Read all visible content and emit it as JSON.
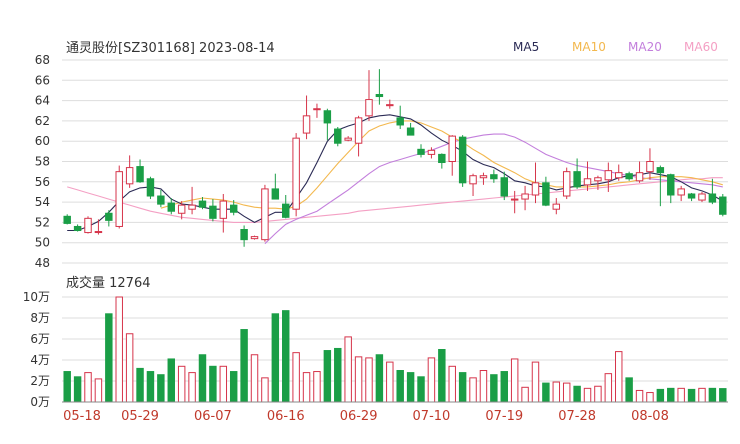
{
  "header": {
    "title": "通灵股份[SZ301168] 2023-08-14",
    "legend": [
      {
        "label": "MA5",
        "color": "#2b2b55"
      },
      {
        "label": "MA10",
        "color": "#f3b84e"
      },
      {
        "label": "MA20",
        "color": "#c37fdc"
      },
      {
        "label": "MA60",
        "color": "#f4a0c4"
      }
    ]
  },
  "colors": {
    "up": "#d6344a",
    "down": "#1a9e46",
    "grid": "#dddddd",
    "axis_text": "#333333",
    "date_text": "#c0392b"
  },
  "chart_data": [
    {
      "type": "candlestick",
      "ylim": [
        48,
        68
      ],
      "yticks": [
        48,
        50,
        52,
        54,
        56,
        58,
        60,
        62,
        64,
        66,
        68
      ],
      "x_labels": [
        {
          "index": 0,
          "label": "05-18"
        },
        {
          "index": 7,
          "label": "05-29"
        },
        {
          "index": 14,
          "label": "06-07"
        },
        {
          "index": 21,
          "label": "06-16"
        },
        {
          "index": 28,
          "label": "06-29"
        },
        {
          "index": 35,
          "label": "07-10"
        },
        {
          "index": 42,
          "label": "07-19"
        },
        {
          "index": 49,
          "label": "07-28"
        },
        {
          "index": 56,
          "label": "08-08"
        }
      ],
      "ohlc": [
        [
          52.6,
          52.8,
          51.8,
          51.9
        ],
        [
          51.6,
          51.8,
          51.1,
          51.2
        ],
        [
          51.0,
          52.6,
          50.9,
          52.4
        ],
        [
          51.1,
          52.3,
          50.8,
          51.1
        ],
        [
          52.9,
          53.2,
          51.6,
          52.2
        ],
        [
          51.6,
          57.6,
          51.4,
          57.0
        ],
        [
          55.8,
          58.6,
          55.4,
          57.4
        ],
        [
          57.5,
          58.2,
          55.9,
          56.0
        ],
        [
          56.3,
          56.5,
          54.3,
          54.6
        ],
        [
          54.6,
          55.2,
          53.5,
          53.8
        ],
        [
          53.9,
          54.4,
          52.8,
          53.1
        ],
        [
          52.9,
          54.1,
          52.3,
          53.7
        ],
        [
          53.3,
          55.5,
          52.8,
          53.7
        ],
        [
          54.1,
          54.5,
          53.3,
          53.5
        ],
        [
          53.6,
          54.3,
          52.1,
          52.4
        ],
        [
          52.4,
          54.8,
          51.0,
          54.1
        ],
        [
          53.7,
          54.2,
          52.7,
          53.0
        ],
        [
          51.3,
          51.7,
          49.6,
          50.3
        ],
        [
          50.4,
          50.7,
          50.3,
          50.6
        ],
        [
          50.3,
          55.7,
          50.1,
          55.3
        ],
        [
          55.3,
          56.8,
          54.3,
          54.3
        ],
        [
          53.8,
          54.7,
          52.4,
          52.5
        ],
        [
          53.3,
          60.8,
          52.6,
          60.3
        ],
        [
          60.8,
          64.5,
          60.2,
          62.5
        ],
        [
          63.2,
          63.7,
          62.3,
          63.2
        ],
        [
          63.0,
          63.2,
          60.1,
          61.8
        ],
        [
          61.2,
          61.4,
          59.5,
          59.8
        ],
        [
          60.1,
          60.5,
          60.0,
          60.3
        ],
        [
          59.8,
          62.5,
          58.5,
          62.3
        ],
        [
          62.5,
          67.0,
          62.0,
          64.1
        ],
        [
          64.6,
          67.1,
          63.6,
          64.4
        ],
        [
          63.5,
          64.1,
          63.2,
          63.6
        ],
        [
          62.3,
          63.5,
          61.2,
          61.6
        ],
        [
          61.3,
          61.8,
          60.6,
          60.6
        ],
        [
          59.2,
          59.7,
          58.4,
          58.7
        ],
        [
          58.7,
          59.4,
          58.3,
          59.1
        ],
        [
          58.7,
          58.8,
          57.3,
          57.9
        ],
        [
          58.0,
          60.6,
          56.6,
          60.5
        ],
        [
          60.4,
          60.6,
          55.5,
          55.9
        ],
        [
          55.8,
          56.8,
          54.6,
          56.6
        ],
        [
          56.4,
          56.9,
          55.7,
          56.6
        ],
        [
          56.7,
          57.2,
          55.9,
          56.3
        ],
        [
          56.4,
          57.0,
          54.2,
          54.6
        ],
        [
          54.2,
          55.1,
          52.9,
          54.3
        ],
        [
          54.3,
          55.6,
          53.2,
          54.8
        ],
        [
          54.7,
          57.9,
          53.9,
          55.9
        ],
        [
          55.9,
          56.5,
          53.6,
          53.7
        ],
        [
          53.3,
          54.4,
          52.8,
          53.8
        ],
        [
          54.6,
          57.4,
          54.3,
          57.0
        ],
        [
          57.0,
          58.3,
          55.3,
          55.5
        ],
        [
          55.7,
          58.0,
          55.1,
          56.3
        ],
        [
          56.1,
          56.6,
          55.2,
          56.4
        ],
        [
          56.2,
          57.9,
          55.0,
          57.1
        ],
        [
          56.4,
          57.7,
          56.1,
          56.9
        ],
        [
          56.8,
          57.0,
          56.1,
          56.3
        ],
        [
          56.1,
          58.0,
          55.9,
          56.9
        ],
        [
          57.0,
          59.3,
          56.2,
          58.0
        ],
        [
          57.4,
          57.6,
          53.6,
          56.9
        ],
        [
          56.7,
          56.8,
          53.9,
          54.7
        ],
        [
          54.7,
          55.6,
          54.1,
          55.3
        ],
        [
          54.8,
          54.9,
          54.1,
          54.4
        ],
        [
          54.2,
          55.0,
          54.0,
          54.8
        ],
        [
          54.8,
          56.3,
          53.8,
          54.0
        ],
        [
          54.5,
          54.8,
          52.6,
          52.8
        ]
      ],
      "ma5": [
        51.2,
        51.2,
        51.6,
        52.1,
        53.0,
        54.1,
        55.0,
        55.4,
        55.5,
        55.3,
        54.3,
        53.8,
        53.7,
        53.5,
        53.3,
        53.3,
        53.3,
        52.6,
        52.0,
        52.5,
        53.0,
        53.0,
        54.4,
        55.9,
        57.9,
        60.0,
        61.1,
        61.5,
        61.8,
        62.3,
        62.5,
        62.6,
        62.4,
        62.2,
        61.6,
        60.8,
        60.1,
        59.6,
        59.0,
        58.2,
        57.7,
        57.4,
        56.8,
        56.1,
        55.9,
        55.6,
        55.5,
        55.2,
        55.4,
        55.6,
        55.7,
        55.8,
        56.0,
        56.4,
        56.6,
        56.7,
        56.9,
        56.7,
        56.5,
        56.0,
        55.4,
        55.1,
        54.7,
        54.1
      ],
      "ma10": [
        null,
        null,
        null,
        null,
        null,
        null,
        null,
        null,
        null,
        53.4,
        53.7,
        54.0,
        54.2,
        54.4,
        54.3,
        54.2,
        54.0,
        53.7,
        53.5,
        53.4,
        53.4,
        53.3,
        53.6,
        54.3,
        55.4,
        56.6,
        57.8,
        58.9,
        60.0,
        61.0,
        61.5,
        61.8,
        62.0,
        62.0,
        61.8,
        61.4,
        61.0,
        60.4,
        59.9,
        59.2,
        58.6,
        57.9,
        57.4,
        56.9,
        56.3,
        55.9,
        55.7,
        55.5,
        55.5,
        55.5,
        55.5,
        55.6,
        55.7,
        55.9,
        56.0,
        56.2,
        56.4,
        56.5,
        56.5,
        56.5,
        56.4,
        56.2,
        56.0,
        55.7
      ],
      "ma20": [
        null,
        null,
        null,
        null,
        null,
        null,
        null,
        null,
        null,
        null,
        null,
        null,
        null,
        null,
        null,
        null,
        null,
        null,
        null,
        49.9,
        50.9,
        51.8,
        52.3,
        52.7,
        53.1,
        53.8,
        54.5,
        55.2,
        56.0,
        56.8,
        57.5,
        57.9,
        58.2,
        58.5,
        58.8,
        59.1,
        59.5,
        59.9,
        60.2,
        60.4,
        60.6,
        60.7,
        60.7,
        60.4,
        59.9,
        59.3,
        58.7,
        58.3,
        57.9,
        57.6,
        57.4,
        57.2,
        57.0,
        56.8,
        56.6,
        56.4,
        56.3,
        56.2,
        56.1,
        56.0,
        55.9,
        55.8,
        55.7,
        55.5
      ],
      "ma60": [
        55.5,
        55.2,
        54.9,
        54.6,
        54.3,
        54.0,
        53.7,
        53.4,
        53.1,
        52.9,
        52.7,
        52.5,
        52.4,
        52.3,
        52.2,
        52.1,
        52.0,
        52.0,
        52.0,
        52.1,
        52.2,
        52.3,
        52.4,
        52.5,
        52.6,
        52.7,
        52.8,
        52.9,
        53.1,
        53.2,
        53.3,
        53.4,
        53.5,
        53.6,
        53.7,
        53.8,
        53.9,
        54.0,
        54.1,
        54.2,
        54.3,
        54.4,
        54.5,
        54.6,
        54.7,
        54.8,
        54.9,
        55.0,
        55.1,
        55.2,
        55.3,
        55.4,
        55.5,
        55.6,
        55.7,
        55.8,
        55.9,
        56.0,
        56.1,
        56.2,
        56.3,
        56.3,
        56.4,
        56.4
      ]
    },
    {
      "type": "bar",
      "title": "成交量 12764",
      "yticks": [
        {
          "value": 0,
          "label": "0万"
        },
        {
          "value": 20000,
          "label": "2万"
        },
        {
          "value": 40000,
          "label": "4万"
        },
        {
          "value": 60000,
          "label": "6万"
        },
        {
          "value": 80000,
          "label": "8万"
        },
        {
          "value": 100000,
          "label": "10万"
        }
      ],
      "ylim": [
        0,
        100000
      ],
      "values": [
        29000,
        24000,
        28000,
        22000,
        84000,
        100000,
        65000,
        32000,
        29000,
        26000,
        41000,
        34000,
        28000,
        45000,
        34000,
        34000,
        29000,
        69000,
        45000,
        23000,
        84000,
        87000,
        47000,
        28000,
        29000,
        49000,
        51000,
        62000,
        43000,
        42000,
        45000,
        38000,
        30000,
        28000,
        24000,
        42000,
        50000,
        34000,
        28000,
        23000,
        30000,
        26000,
        29000,
        41000,
        14000,
        38000,
        18000,
        19000,
        18000,
        15000,
        13000,
        15000,
        27000,
        48000,
        23000,
        11000,
        9000,
        12000,
        13000,
        13000,
        12000,
        13000,
        13000,
        12764
      ]
    }
  ]
}
